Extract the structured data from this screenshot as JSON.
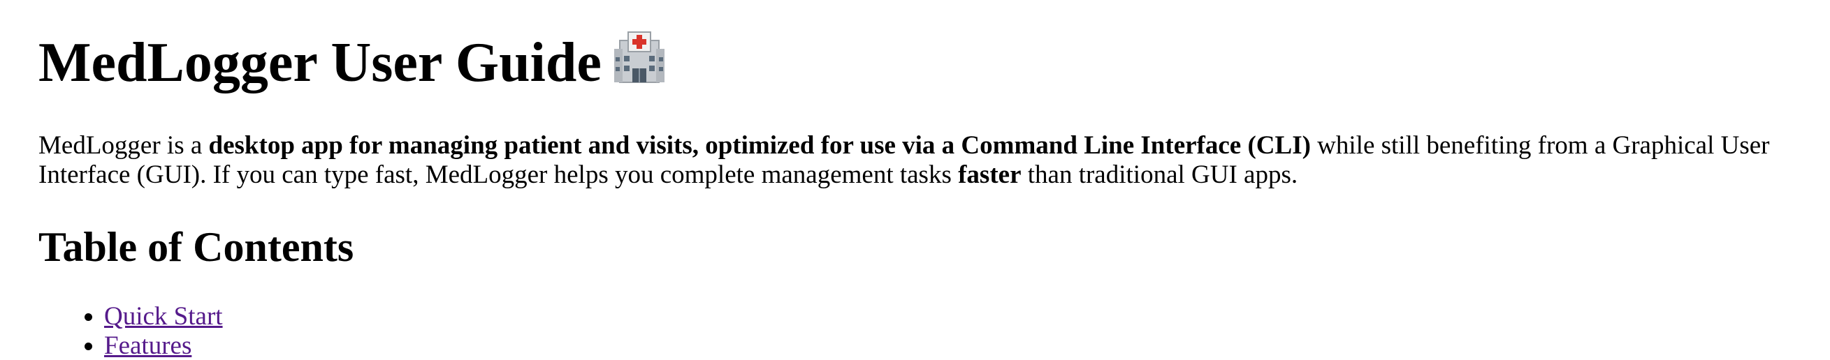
{
  "title": {
    "text": "MedLogger User Guide",
    "icon": "hospital-icon"
  },
  "intro": {
    "part1": "MedLogger is a ",
    "bold1": "desktop app for managing patient and visits, optimized for use via a Command Line Interface (CLI)",
    "part2": " while still benefiting from a Graphical User Interface (GUI). If you can type fast, MedLogger helps you complete management tasks ",
    "bold2": "faster",
    "part3": " than traditional GUI apps."
  },
  "toc": {
    "heading": "Table of Contents",
    "items": [
      {
        "label": "Quick Start"
      },
      {
        "label": "Features"
      }
    ]
  },
  "colors": {
    "visited_link": "#551a8b",
    "text": "#000000",
    "background": "#ffffff"
  }
}
